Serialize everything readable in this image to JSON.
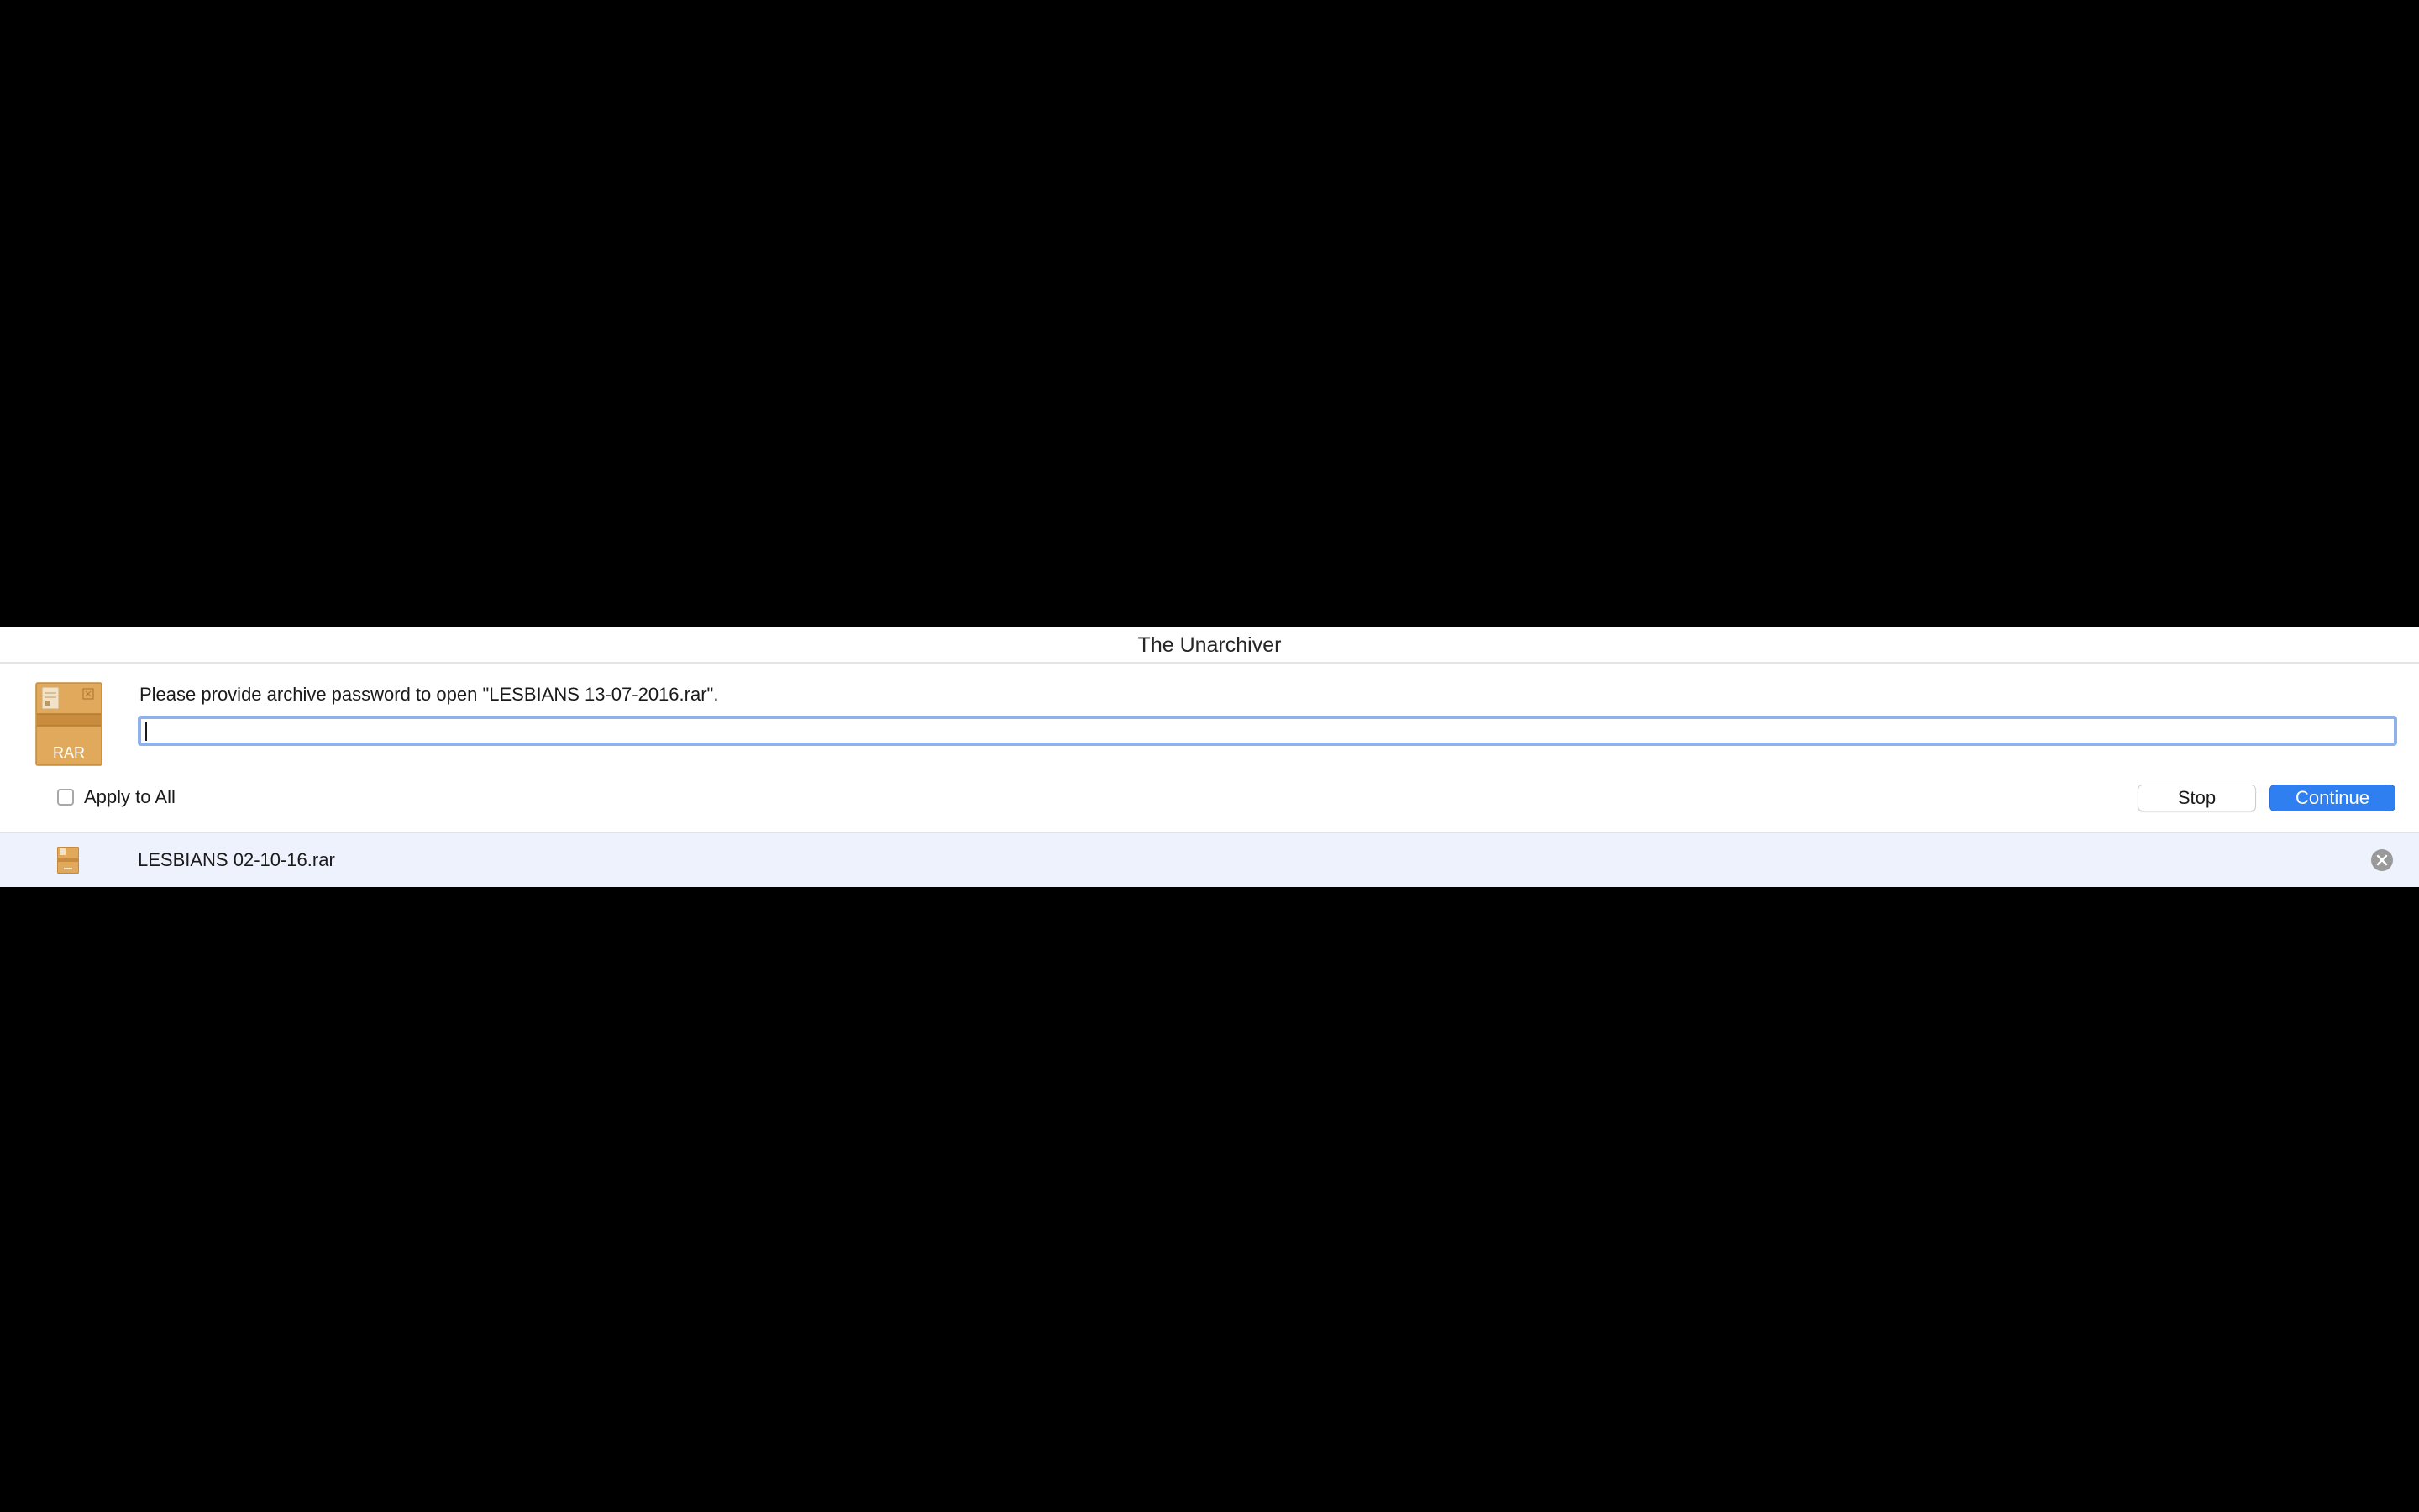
{
  "window": {
    "title": "The Unarchiver"
  },
  "dialog": {
    "icon": "rar-archive-icon",
    "icon_label": "RAR",
    "prompt": "Please provide archive password to open \"LESBIANS 13-07-2016.rar\".",
    "password_value": "",
    "apply_to_all_label": "Apply to All",
    "apply_to_all_checked": false,
    "stop_label": "Stop",
    "continue_label": "Continue"
  },
  "queue": {
    "items": [
      {
        "icon": "rar-archive-small-icon",
        "name": "LESBIANS 02-10-16.rar",
        "remove_icon": "remove-circle-icon"
      }
    ]
  },
  "colors": {
    "accent": "#2f7ff0",
    "focus_ring": "#8fb2ec",
    "row_highlight": "#eef2fc",
    "archive_tan": "#e1a95b"
  }
}
